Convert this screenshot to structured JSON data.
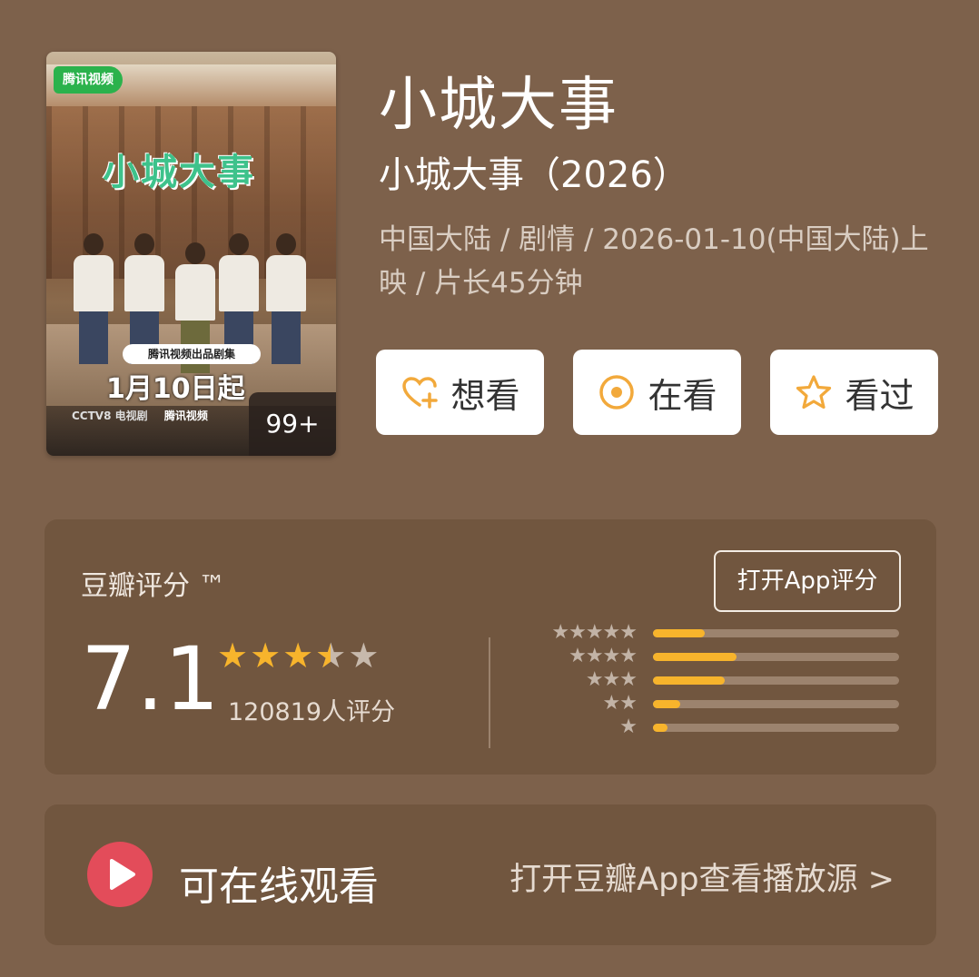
{
  "poster": {
    "platform_logo": "腾讯视频",
    "title": "小城大事",
    "tagline": "腾讯视频出品剧集",
    "release_text": "1月10日起",
    "credits_line": "CCTV8 电视剧",
    "platform_small": "腾讯视频",
    "badge": "99+"
  },
  "header": {
    "title": "小城大事",
    "subtitle": "小城大事（2026）",
    "meta": "中国大陆 / 剧情 / 2026-01-10(中国大陆)上映 / 片长45分钟"
  },
  "actions": [
    {
      "label": "想看",
      "icon": "heart-plus-icon"
    },
    {
      "label": "在看",
      "icon": "target-icon"
    },
    {
      "label": "看过",
      "icon": "star-outline-icon"
    }
  ],
  "rating": {
    "label": "豆瓣评分 ™",
    "open_app": "打开App评分",
    "score": "7.1",
    "stars_value": 3.5,
    "votes": "120819人评分",
    "distribution": [
      {
        "stars": 5,
        "fraction": 0.21
      },
      {
        "stars": 4,
        "fraction": 0.34
      },
      {
        "stars": 3,
        "fraction": 0.29
      },
      {
        "stars": 2,
        "fraction": 0.11
      },
      {
        "stars": 1,
        "fraction": 0.06
      }
    ]
  },
  "watch": {
    "label": "可在线观看",
    "link": "打开豆瓣App查看播放源 >"
  },
  "colors": {
    "background": "#7d614b",
    "card": "#71563f",
    "accent_star": "#f7b42c",
    "play_red": "#e34c5a"
  }
}
